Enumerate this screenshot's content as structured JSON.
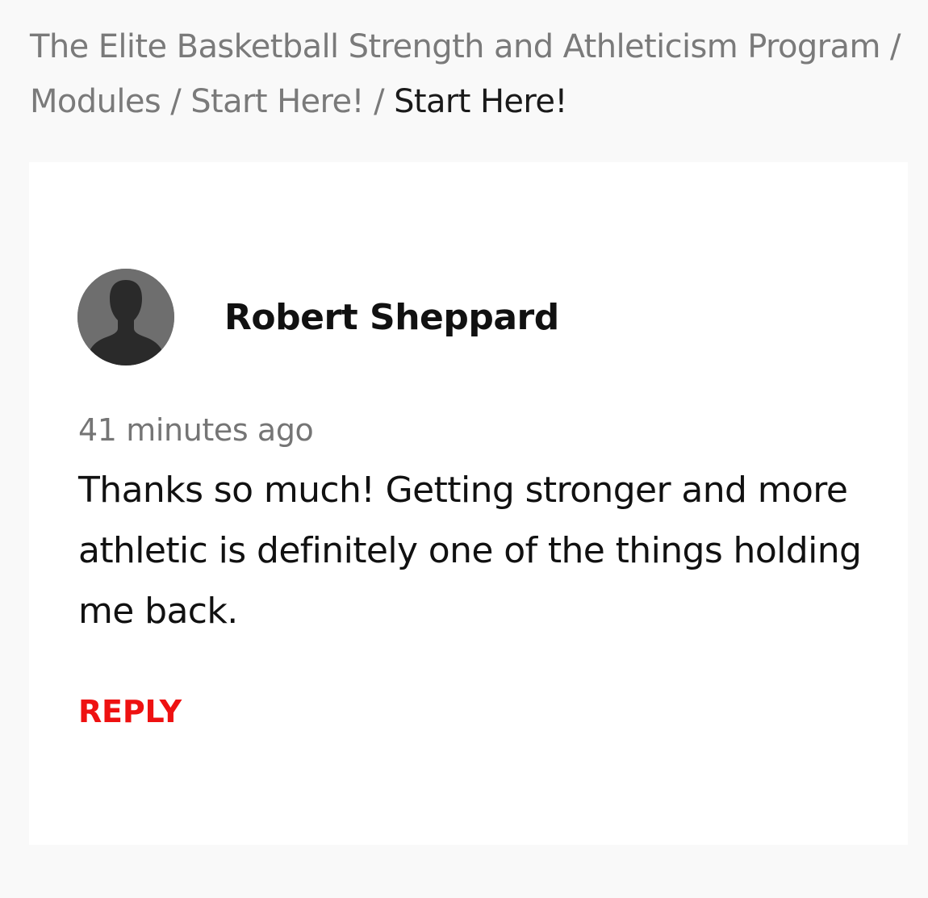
{
  "breadcrumb": {
    "items": [
      "The Elite Basketball Strength and Athleticism Program",
      "Modules",
      "Start Here!"
    ],
    "separator": "/",
    "current": "Start Here!"
  },
  "comment": {
    "avatar_icon": "user-silhouette-icon",
    "author": "Robert Sheppard",
    "timestamp": "41 minutes ago",
    "text": "Thanks so much! Getting stronger and more athletic is definitely one of the things holding me back.",
    "reply_label": "REPLY"
  },
  "colors": {
    "page_background": "#f9f9f9",
    "card_background": "#ffffff",
    "reply_accent": "#ee1111",
    "muted_text": "#7a7a7a"
  }
}
